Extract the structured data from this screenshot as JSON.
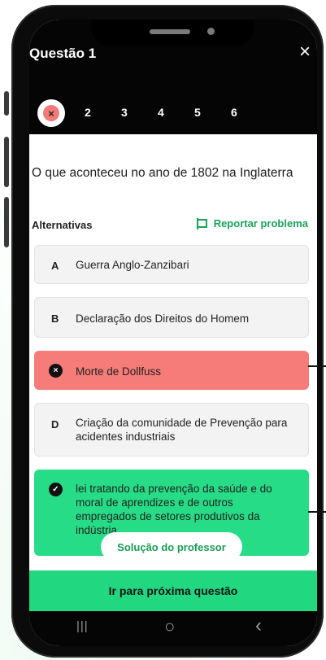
{
  "header": {
    "title": "Questão 1",
    "close_icon": "×"
  },
  "question_nav": {
    "current_status_icon": "×",
    "numbers": [
      "2",
      "3",
      "4",
      "5",
      "6"
    ]
  },
  "question": {
    "text": "O que aconteceu no ano de 1802 na Inglaterra"
  },
  "alternatives": {
    "label": "Alternativas",
    "report_label": "Reportar problema",
    "items": [
      {
        "letter": "A",
        "text": "Guerra Anglo-Zanzibari",
        "state": "neutral"
      },
      {
        "letter": "B",
        "text": "Declaração dos Direitos do Homem",
        "state": "neutral"
      },
      {
        "letter": "×",
        "text": "Morte de Dollfuss",
        "state": "wrong"
      },
      {
        "letter": "D",
        "text": "Criação da comunidade de Prevenção para acidentes industriais",
        "state": "neutral"
      },
      {
        "letter": "✓",
        "text": "lei tratando da prevenção da saúde e do moral de aprendizes e de outros empregados de setores produtivos da indústria",
        "state": "correct"
      }
    ]
  },
  "solution_button": "Solução do professor",
  "next_button": "Ir para próxima questão",
  "system_nav": {
    "recent": "|||",
    "home": "○",
    "back": "‹"
  },
  "colors": {
    "wrong": "#f57c78",
    "correct": "#26dc86",
    "accent": "#19a35a"
  }
}
